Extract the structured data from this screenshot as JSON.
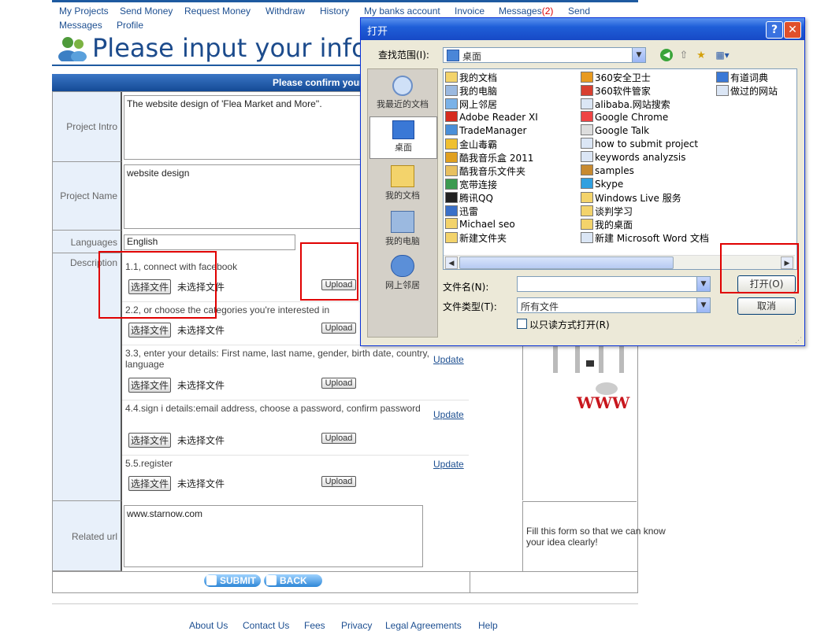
{
  "nav": {
    "items": [
      "My Projects",
      "Send Money",
      "Request Money",
      "Withdraw",
      "History",
      "My banks account",
      "Invoice",
      "Messages",
      "Send",
      "Messages",
      "Profile"
    ],
    "messages_badge": "(2)"
  },
  "header": {
    "title": "Please input your inform",
    "confirm_bar": "Please confirm your"
  },
  "form": {
    "project_intro_label": "Project Intro",
    "project_intro_value": "The website design of 'Flea Market and More''.",
    "project_name_label": "Project Name",
    "project_name_value": "website design",
    "languages_label": "Languages",
    "languages_value": "English",
    "description_label": "Description",
    "choose_file_label": "选择文件",
    "no_file_label": "未选择文件",
    "upload_label": "Upload",
    "update_label": "Update",
    "items": [
      "1.1, connect with facebook",
      "2.2, or choose the categories you're interested in",
      "3.3, enter your details: First name, last name, gender, birth date, country, language",
      "4.4.sign i details:email address, choose a password, confirm password",
      "5.5.register"
    ],
    "related_url_label": "Related url",
    "related_url_value": "www.starnow.com",
    "side_note": "Fill this form so that we can know your idea clearly!",
    "submit_label": "SUBMIT",
    "back_label": "BACK"
  },
  "footer": {
    "links": [
      "About Us",
      "Contact Us",
      "Fees",
      "Privacy",
      "Legal Agreements",
      "Help"
    ]
  },
  "dialog": {
    "title": "打开",
    "help_btn": "?",
    "close_btn": "✕",
    "look_in_label": "查找范围(I):",
    "look_in_value": "桌面",
    "places": [
      "我最近的文档",
      "桌面",
      "我的文档",
      "我的电脑",
      "网上邻居"
    ],
    "files_col1": [
      "我的文档",
      "我的电脑",
      "网上邻居",
      "Adobe Reader XI",
      "TradeManager",
      "金山毒霸",
      "酷我音乐盒 2011",
      "酷我音乐文件夹",
      "宽带连接",
      "腾讯QQ",
      "迅雷",
      "Michael seo",
      "新建文件夹"
    ],
    "files_col2": [
      "360安全卫士",
      "360软件管家",
      "alibaba.网站搜索",
      "Google Chrome",
      "Google Talk",
      "how to submit project",
      "keywords analyzsis",
      "samples",
      "Skype",
      "Windows Live 服务",
      "谈判学习",
      "我的桌面",
      "新建 Microsoft Word 文档"
    ],
    "files_col3": [
      "有道词典",
      "做过的网站"
    ],
    "filename_label": "文件名(N):",
    "filetype_label": "文件类型(T):",
    "filetype_value": "所有文件",
    "readonly_label": "以只读方式打开(R)",
    "open_btn": "打开(O)",
    "cancel_btn": "取消"
  },
  "colors": {
    "brand_blue": "#1e5aa0",
    "highlight_red": "#e00000",
    "xp_title_blue": "#1f5fd8"
  }
}
